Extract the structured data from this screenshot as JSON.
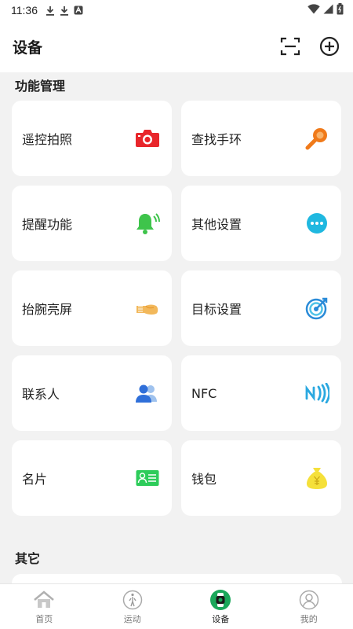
{
  "status_bar": {
    "time": "11:36"
  },
  "header": {
    "title": "设备",
    "scan_icon": "scan-icon",
    "add_icon": "plus-circle-icon"
  },
  "sections": {
    "feature_management": "功能管理",
    "others": "其它"
  },
  "features": [
    {
      "label": "遥控拍照",
      "icon": "camera-icon",
      "color": "#e8262b"
    },
    {
      "label": "查找手环",
      "icon": "search-magnifier-icon",
      "color": "#f07a1a"
    },
    {
      "label": "提醒功能",
      "icon": "bell-icon",
      "color": "#3ec44b"
    },
    {
      "label": "其他设置",
      "icon": "more-dots-icon",
      "color": "#1fb8e0"
    },
    {
      "label": "抬腕亮屏",
      "icon": "raise-wrist-icon",
      "color": "#f2b85b"
    },
    {
      "label": "目标设置",
      "icon": "target-icon",
      "color": "#2a8bd8"
    },
    {
      "label": "联系人",
      "icon": "contacts-icon",
      "color": "#2f6fd9"
    },
    {
      "label": "NFC",
      "icon": "nfc-icon",
      "color": "#2aa8e0"
    },
    {
      "label": "名片",
      "icon": "business-card-icon",
      "color": "#2dcc5a"
    },
    {
      "label": "钱包",
      "icon": "money-bag-icon",
      "color": "#f5e03a"
    }
  ],
  "tabs": [
    {
      "label": "首页",
      "icon": "home-icon",
      "active": false
    },
    {
      "label": "运动",
      "icon": "run-icon",
      "active": false
    },
    {
      "label": "设备",
      "icon": "watch-icon",
      "active": true
    },
    {
      "label": "我的",
      "icon": "profile-icon",
      "active": false
    }
  ]
}
